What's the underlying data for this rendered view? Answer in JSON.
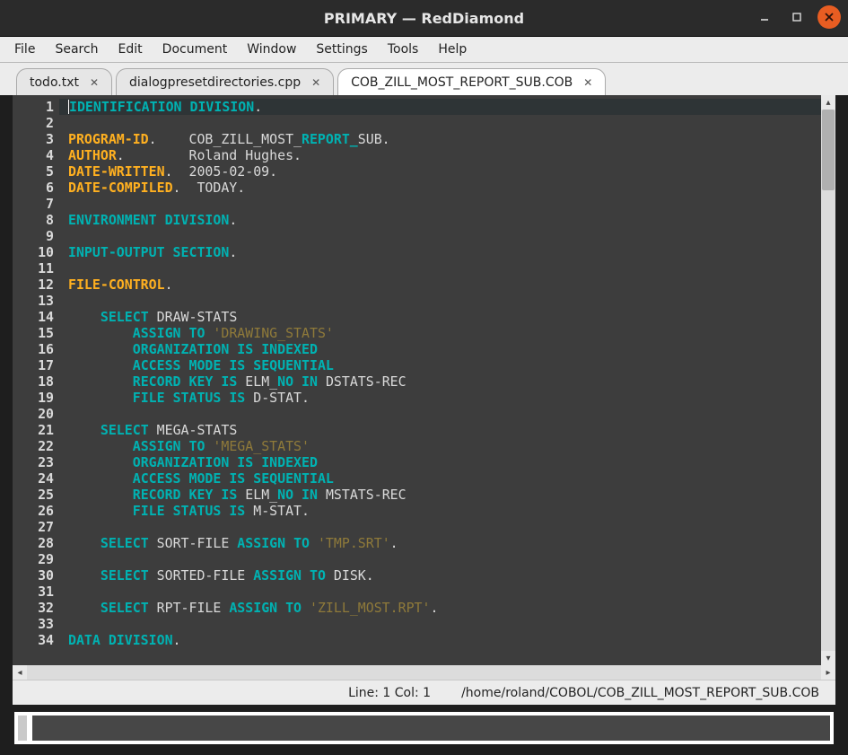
{
  "window": {
    "title": "PRIMARY — RedDiamond"
  },
  "menubar": [
    "File",
    "Search",
    "Edit",
    "Document",
    "Window",
    "Settings",
    "Tools",
    "Help"
  ],
  "tabs": [
    {
      "label": "todo.txt",
      "active": false
    },
    {
      "label": "dialogpresetdirectories.cpp",
      "active": false
    },
    {
      "label": "COB_ZILL_MOST_REPORT_SUB.COB",
      "active": true
    }
  ],
  "status": {
    "linecol": "Line: 1  Col: 1",
    "filepath": "/home/roland/COBOL/COB_ZILL_MOST_REPORT_SUB.COB"
  },
  "code": {
    "lines": [
      [
        {
          "t": "id",
          "v": "IDENTIFICATION DIVISION"
        },
        {
          "t": "punc",
          "v": "."
        }
      ],
      [],
      [
        {
          "t": "kw",
          "v": "PROGRAM-ID"
        },
        {
          "t": "punc",
          "v": ".    "
        },
        {
          "t": "plain",
          "v": "COB_ZILL_MOST_"
        },
        {
          "t": "id",
          "v": "REPORT_"
        },
        {
          "t": "plain",
          "v": "SUB."
        }
      ],
      [
        {
          "t": "kw",
          "v": "AUTHOR"
        },
        {
          "t": "punc",
          "v": "."
        },
        {
          "t": "plain",
          "v": "        Roland Hughes."
        }
      ],
      [
        {
          "t": "kw",
          "v": "DATE-WRITTEN"
        },
        {
          "t": "punc",
          "v": "."
        },
        {
          "t": "plain",
          "v": "  2005-02-09."
        }
      ],
      [
        {
          "t": "kw",
          "v": "DATE-COMPILED"
        },
        {
          "t": "punc",
          "v": "."
        },
        {
          "t": "plain",
          "v": "  TODAY."
        }
      ],
      [],
      [
        {
          "t": "id",
          "v": "ENVIRONMENT DIVISION"
        },
        {
          "t": "punc",
          "v": "."
        }
      ],
      [],
      [
        {
          "t": "id",
          "v": "INPUT-OUTPUT SECTION"
        },
        {
          "t": "punc",
          "v": "."
        }
      ],
      [],
      [
        {
          "t": "kw",
          "v": "FILE-CONTROL"
        },
        {
          "t": "punc",
          "v": "."
        }
      ],
      [],
      [
        {
          "t": "plain",
          "v": "    "
        },
        {
          "t": "id",
          "v": "SELECT"
        },
        {
          "t": "plain",
          "v": " DRAW-STATS"
        }
      ],
      [
        {
          "t": "plain",
          "v": "        "
        },
        {
          "t": "id",
          "v": "ASSIGN "
        },
        {
          "t": "id",
          "v": "TO"
        },
        {
          "t": "plain",
          "v": " "
        },
        {
          "t": "str",
          "v": "'DRAWING_STATS'"
        }
      ],
      [
        {
          "t": "plain",
          "v": "        "
        },
        {
          "t": "id",
          "v": "ORGANIZATION "
        },
        {
          "t": "id",
          "v": "IS "
        },
        {
          "t": "id",
          "v": "INDEXED"
        }
      ],
      [
        {
          "t": "plain",
          "v": "        "
        },
        {
          "t": "id",
          "v": "ACCESS "
        },
        {
          "t": "id",
          "v": "MODE "
        },
        {
          "t": "id",
          "v": "IS "
        },
        {
          "t": "id",
          "v": "SEQUENTIAL"
        }
      ],
      [
        {
          "t": "plain",
          "v": "        "
        },
        {
          "t": "id",
          "v": "RECORD "
        },
        {
          "t": "id",
          "v": "KEY "
        },
        {
          "t": "id",
          "v": "IS"
        },
        {
          "t": "plain",
          "v": " ELM_"
        },
        {
          "t": "id",
          "v": "NO "
        },
        {
          "t": "id",
          "v": "IN"
        },
        {
          "t": "plain",
          "v": " DSTATS-REC"
        }
      ],
      [
        {
          "t": "plain",
          "v": "        "
        },
        {
          "t": "id",
          "v": "FILE "
        },
        {
          "t": "id",
          "v": "STATUS "
        },
        {
          "t": "id",
          "v": "IS"
        },
        {
          "t": "plain",
          "v": " D-STAT."
        }
      ],
      [],
      [
        {
          "t": "plain",
          "v": "    "
        },
        {
          "t": "id",
          "v": "SELECT"
        },
        {
          "t": "plain",
          "v": " MEGA-STATS"
        }
      ],
      [
        {
          "t": "plain",
          "v": "        "
        },
        {
          "t": "id",
          "v": "ASSIGN "
        },
        {
          "t": "id",
          "v": "TO"
        },
        {
          "t": "plain",
          "v": " "
        },
        {
          "t": "str",
          "v": "'MEGA_STATS'"
        }
      ],
      [
        {
          "t": "plain",
          "v": "        "
        },
        {
          "t": "id",
          "v": "ORGANIZATION "
        },
        {
          "t": "id",
          "v": "IS "
        },
        {
          "t": "id",
          "v": "INDEXED"
        }
      ],
      [
        {
          "t": "plain",
          "v": "        "
        },
        {
          "t": "id",
          "v": "ACCESS "
        },
        {
          "t": "id",
          "v": "MODE "
        },
        {
          "t": "id",
          "v": "IS "
        },
        {
          "t": "id",
          "v": "SEQUENTIAL"
        }
      ],
      [
        {
          "t": "plain",
          "v": "        "
        },
        {
          "t": "id",
          "v": "RECORD "
        },
        {
          "t": "id",
          "v": "KEY "
        },
        {
          "t": "id",
          "v": "IS"
        },
        {
          "t": "plain",
          "v": " ELM_"
        },
        {
          "t": "id",
          "v": "NO "
        },
        {
          "t": "id",
          "v": "IN"
        },
        {
          "t": "plain",
          "v": " MSTATS-REC"
        }
      ],
      [
        {
          "t": "plain",
          "v": "        "
        },
        {
          "t": "id",
          "v": "FILE "
        },
        {
          "t": "id",
          "v": "STATUS "
        },
        {
          "t": "id",
          "v": "IS"
        },
        {
          "t": "plain",
          "v": " M-STAT."
        }
      ],
      [],
      [
        {
          "t": "plain",
          "v": "    "
        },
        {
          "t": "id",
          "v": "SELECT"
        },
        {
          "t": "plain",
          "v": " SORT-FILE "
        },
        {
          "t": "id",
          "v": "ASSIGN "
        },
        {
          "t": "id",
          "v": "TO"
        },
        {
          "t": "plain",
          "v": " "
        },
        {
          "t": "str",
          "v": "'TMP.SRT'"
        },
        {
          "t": "punc",
          "v": "."
        }
      ],
      [],
      [
        {
          "t": "plain",
          "v": "    "
        },
        {
          "t": "id",
          "v": "SELECT"
        },
        {
          "t": "plain",
          "v": " SORTED-FILE "
        },
        {
          "t": "id",
          "v": "ASSIGN "
        },
        {
          "t": "id",
          "v": "TO"
        },
        {
          "t": "plain",
          "v": " DISK."
        }
      ],
      [],
      [
        {
          "t": "plain",
          "v": "    "
        },
        {
          "t": "id",
          "v": "SELECT"
        },
        {
          "t": "plain",
          "v": " RPT-FILE "
        },
        {
          "t": "id",
          "v": "ASSIGN "
        },
        {
          "t": "id",
          "v": "TO"
        },
        {
          "t": "plain",
          "v": " "
        },
        {
          "t": "str",
          "v": "'ZILL_MOST.RPT'"
        },
        {
          "t": "punc",
          "v": "."
        }
      ],
      [],
      [
        {
          "t": "id",
          "v": "DATA DIVISION"
        },
        {
          "t": "punc",
          "v": "."
        }
      ]
    ]
  }
}
